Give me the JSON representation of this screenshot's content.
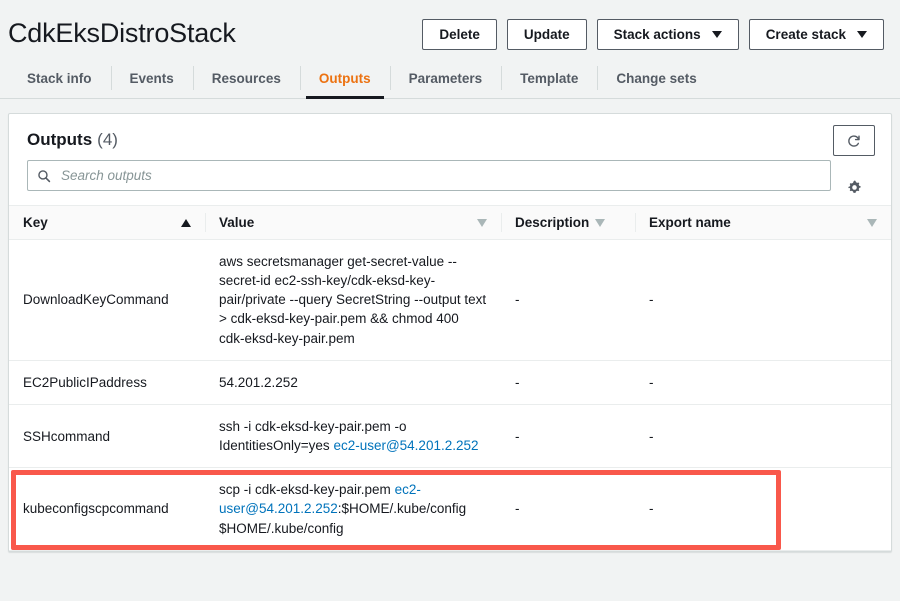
{
  "header": {
    "stack_title": "CdkEksDistroStack",
    "buttons": [
      {
        "label": "Delete",
        "has_caret": false
      },
      {
        "label": "Update",
        "has_caret": false
      },
      {
        "label": "Stack actions",
        "has_caret": true
      },
      {
        "label": "Create stack",
        "has_caret": true
      }
    ]
  },
  "tabs": [
    {
      "label": "Stack info",
      "active": false
    },
    {
      "label": "Events",
      "active": false
    },
    {
      "label": "Resources",
      "active": false
    },
    {
      "label": "Outputs",
      "active": true
    },
    {
      "label": "Parameters",
      "active": false
    },
    {
      "label": "Template",
      "active": false
    },
    {
      "label": "Change sets",
      "active": false
    }
  ],
  "panel": {
    "title": "Outputs",
    "count": "(4)",
    "refresh_icon": "refresh-icon",
    "settings_icon": "gear-icon",
    "search": {
      "icon": "search-icon",
      "placeholder": "Search outputs",
      "value": ""
    }
  },
  "table": {
    "columns": [
      {
        "label": "Key",
        "sort": "asc"
      },
      {
        "label": "Value",
        "sort": "none"
      },
      {
        "label": "Description",
        "sort": "none"
      },
      {
        "label": "Export name",
        "sort": "none"
      }
    ],
    "rows": [
      {
        "key": "DownloadKeyCommand",
        "value_parts": [
          {
            "text": "aws secretsmanager get-secret-value --secret-id ec2-ssh-key/cdk-eksd-key-pair/private --query SecretString --output text > cdk-eksd-key-pair.pem && chmod 400 cdk-eksd-key-pair.pem",
            "link": false
          }
        ],
        "description": "-",
        "export_name": "-",
        "highlighted": false
      },
      {
        "key": "EC2PublicIPaddress",
        "value_parts": [
          {
            "text": "54.201.2.252",
            "link": false
          }
        ],
        "description": "-",
        "export_name": "-",
        "highlighted": false
      },
      {
        "key": "SSHcommand",
        "value_parts": [
          {
            "text": "ssh -i cdk-eksd-key-pair.pem -o IdentitiesOnly=yes ",
            "link": false
          },
          {
            "text": "ec2-user@54.201.2.252",
            "link": true
          }
        ],
        "description": "-",
        "export_name": "-",
        "highlighted": false
      },
      {
        "key": "kubeconfigscpcommand",
        "value_parts": [
          {
            "text": "scp -i cdk-eksd-key-pair.pem ",
            "link": false
          },
          {
            "text": "ec2-user@54.201.2.252",
            "link": true
          },
          {
            "text": ":$HOME/.kube/config $HOME/.kube/config",
            "link": false
          }
        ],
        "description": "-",
        "export_name": "-",
        "highlighted": true
      }
    ]
  },
  "colors": {
    "accent_orange": "#ec7211",
    "link_blue": "#0073bb",
    "highlight_red": "#f9584b",
    "page_bg": "#f1f3f3",
    "text": "#16191f"
  }
}
